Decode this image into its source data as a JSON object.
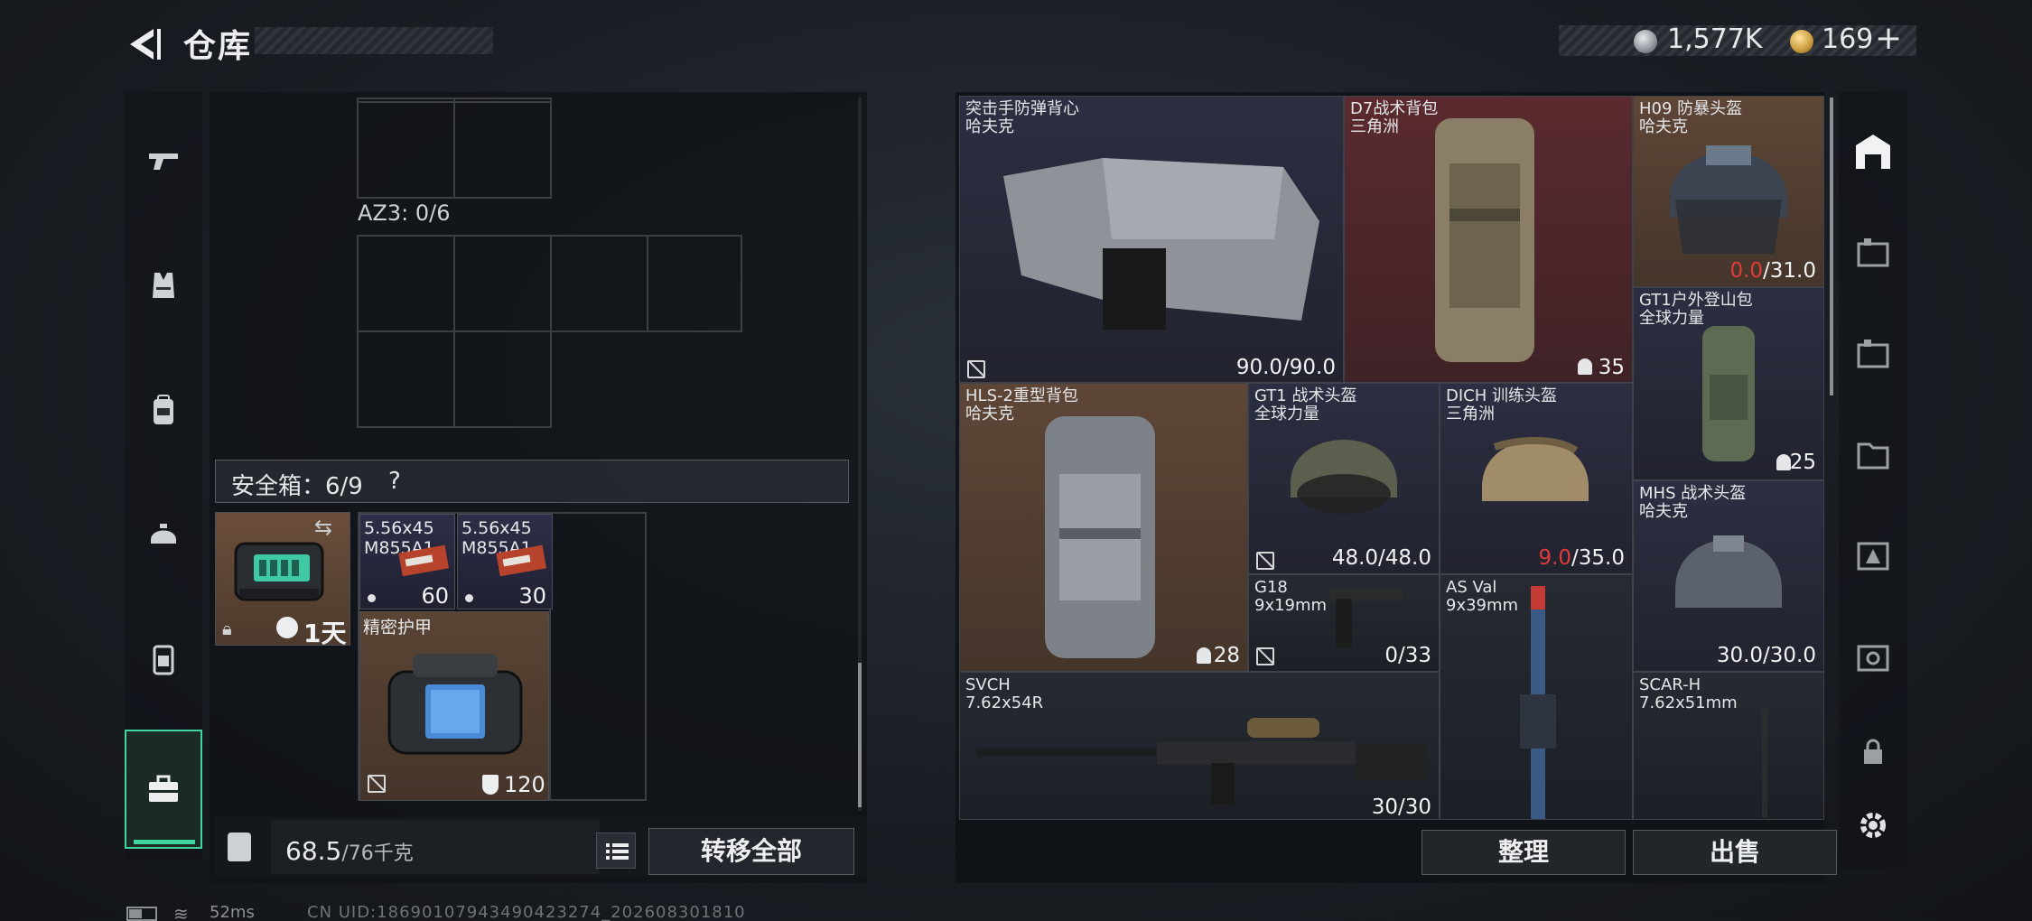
{
  "header": {
    "title": "仓库"
  },
  "currency": {
    "silver": "1,577K",
    "gold": "169",
    "plus": "+"
  },
  "left_nav": {
    "items": [
      "weapon-icon",
      "vest-icon",
      "backpack-icon",
      "helmet-icon",
      "container-icon",
      "safebox-icon"
    ],
    "active": "safebox-icon"
  },
  "left_panel": {
    "az3_label": "AZ3: 0/6",
    "safebox": {
      "label": "安全箱：6/9",
      "help": "?"
    },
    "device": {
      "time": "1天"
    },
    "ammo": [
      {
        "line1": "5.56x45",
        "line2": "M855A1",
        "count": "60"
      },
      {
        "line1": "5.56x45",
        "line2": "M855A1",
        "count": "30"
      }
    ],
    "armor": {
      "name": "精密护甲",
      "value": "120"
    },
    "weight": {
      "value": "68.5",
      "capacity": "/76千克"
    },
    "transfer_label": "转移全部"
  },
  "stash": {
    "items": [
      {
        "name": "突击手防弹背心",
        "brand": "哈夫克",
        "value": "90.0/90.0"
      },
      {
        "name": "D7战术背包",
        "brand": "三角洲",
        "value": "35"
      },
      {
        "name": "H09 防暴头盔",
        "brand": "哈夫克",
        "value_red": "0.0",
        "value_rest": "/31.0"
      },
      {
        "name": "GT1户外登山包",
        "brand": "全球力量",
        "value": "25"
      },
      {
        "name": "HLS-2重型背包",
        "brand": "哈夫克",
        "value": "28"
      },
      {
        "name": "GT1 战术头盔",
        "brand": "全球力量",
        "value": "48.0/48.0"
      },
      {
        "name": "DICH 训练头盔",
        "brand": "三角洲",
        "value_red": "9.0",
        "value_rest": "/35.0"
      },
      {
        "name": "MHS 战术头盔",
        "brand": "哈夫克",
        "value": "30.0/30.0"
      },
      {
        "name": "G18",
        "brand": "9x19mm",
        "value": "0/33"
      },
      {
        "name": "AS Val",
        "brand": "9x39mm",
        "value": ""
      },
      {
        "name": "SVCH",
        "brand": "7.62x54R",
        "value": "30/30"
      },
      {
        "name": "SCAR-H",
        "brand": "7.62x51mm",
        "value": ""
      }
    ],
    "sort_label": "整理",
    "sell_label": "出售"
  },
  "status": {
    "ping": "52ms",
    "uid": "CN UID:18690107943490423274_202608301810"
  }
}
